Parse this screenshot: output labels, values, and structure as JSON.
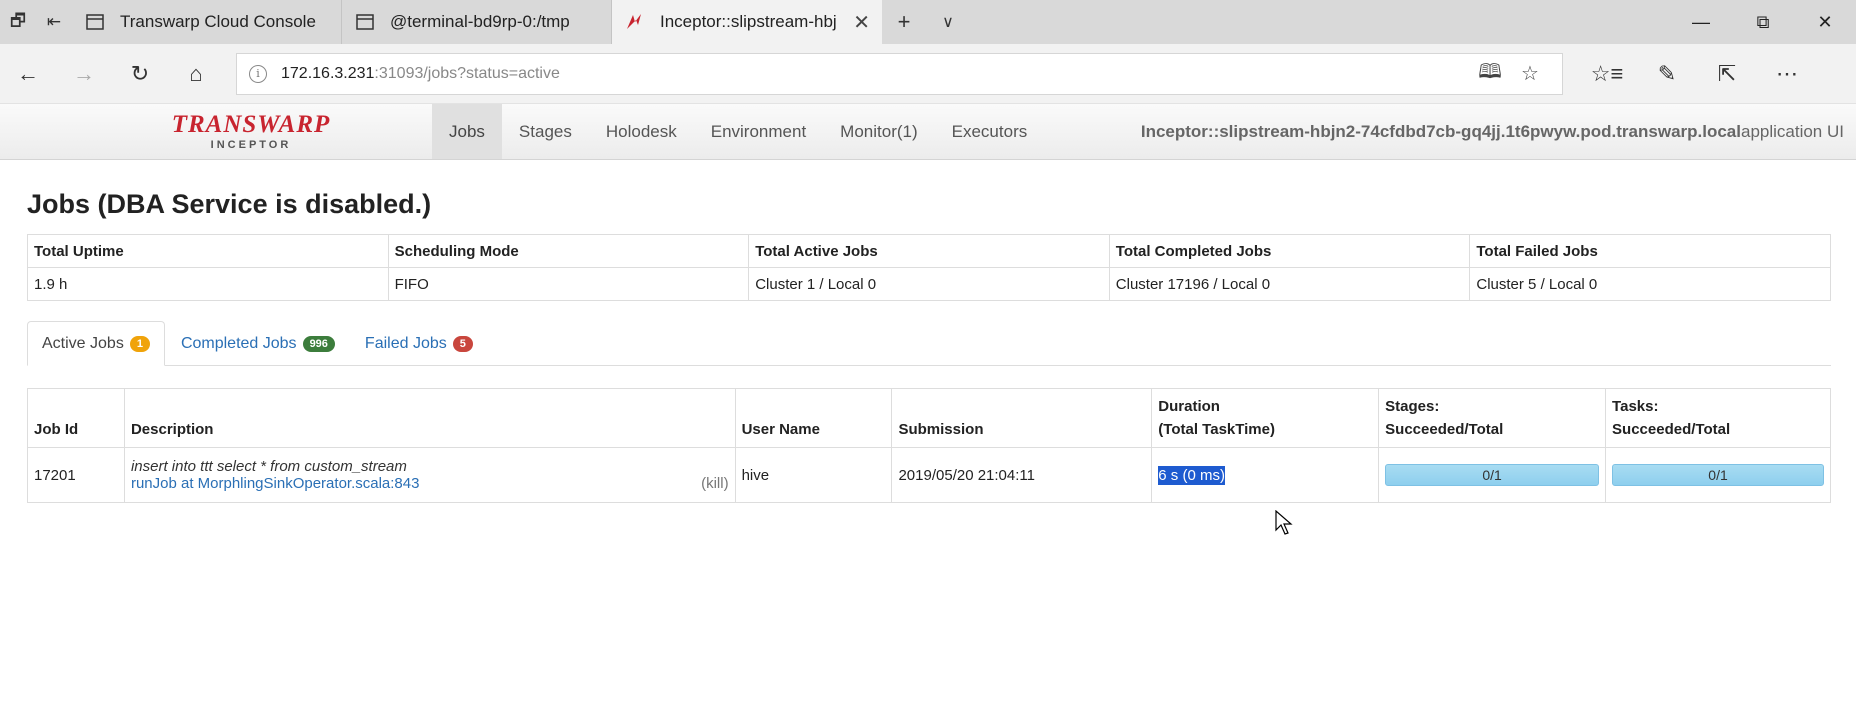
{
  "browser": {
    "tabs": [
      {
        "label": "Transwarp Cloud Console",
        "icon": "page-icon"
      },
      {
        "label": "@terminal-bd9rp-0:/tmp",
        "icon": "page-icon"
      },
      {
        "label": "Inceptor::slipstream-hbj",
        "icon": "transwarp-icon",
        "active": true
      }
    ],
    "url_host": "172.16.3.231",
    "url_path": ":31093/jobs?status=active"
  },
  "appnav": {
    "brand": "TRANSWARP",
    "brand_sub": "INCEPTOR",
    "tabs": [
      "Jobs",
      "Stages",
      "Holodesk",
      "Environment",
      "Monitor(1)",
      "Executors"
    ],
    "active_tab": "Jobs",
    "app_name": "Inceptor::slipstream-hbjn2-74cfdbd7cb-gq4jj.1t6pwyw.pod.transwarp.local",
    "app_suffix": " application UI"
  },
  "page": {
    "title": "Jobs (DBA Service is disabled.)"
  },
  "summary": {
    "headers": [
      "Total Uptime",
      "Scheduling Mode",
      "Total Active Jobs",
      "Total Completed Jobs",
      "Total Failed Jobs"
    ],
    "values": [
      "1.9 h",
      "FIFO",
      "Cluster 1 / Local 0",
      "Cluster 17196 / Local 0",
      "Cluster 5 / Local 0"
    ]
  },
  "job_tabs": [
    {
      "label": "Active Jobs",
      "count": "1",
      "color": "#f0a30a"
    },
    {
      "label": "Completed Jobs",
      "count": "996",
      "color": "#3c7d3c"
    },
    {
      "label": "Failed Jobs",
      "count": "5",
      "color": "#c9463d"
    }
  ],
  "jobs_table": {
    "headers": {
      "job_id": "Job Id",
      "description": "Description",
      "user": "User Name",
      "submission": "Submission",
      "duration_1": "Duration",
      "duration_2": "(Total TaskTime)",
      "stages_1": "Stages:",
      "stages_2": "Succeeded/Total",
      "tasks_1": "Tasks:",
      "tasks_2": "Succeeded/Total"
    },
    "rows": [
      {
        "job_id": "17201",
        "description": "insert into ttt select * from custom_stream",
        "link": "runJob at MorphlingSinkOperator.scala:843",
        "kill": "(kill)",
        "user": "hive",
        "submission": "2019/05/20 21:04:11",
        "duration": "6 s (0 ms)",
        "stages_label": "0/1",
        "stages_progress": 0,
        "tasks_label": "0/1",
        "tasks_progress": 0
      }
    ]
  }
}
